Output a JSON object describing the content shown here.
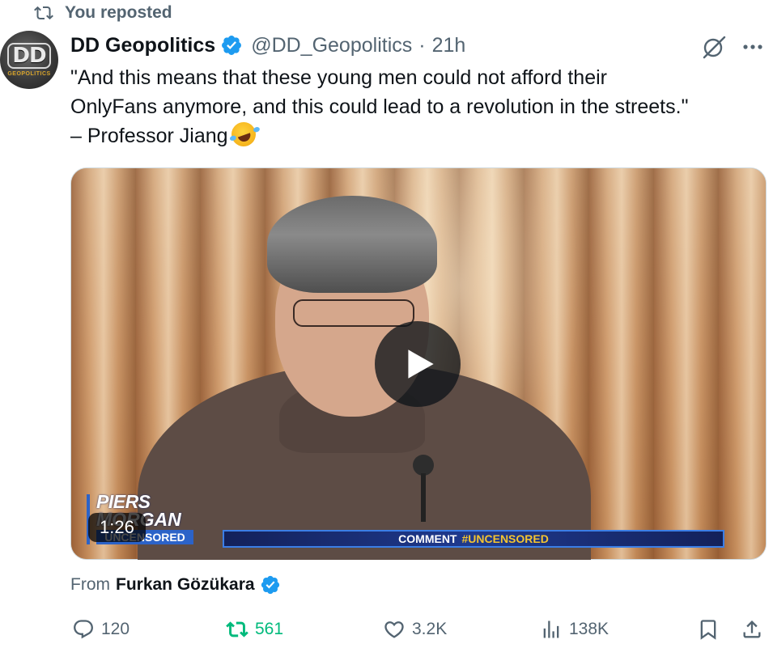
{
  "repost_banner": {
    "text": "You reposted",
    "icon": "repost-icon"
  },
  "author": {
    "name": "DD Geopolitics",
    "handle": "@DD_Geopolitics",
    "separator": "·",
    "time": "21h",
    "verified": true,
    "avatar_text": "DD",
    "avatar_subtext": "GEOPOLITICS"
  },
  "tweet": {
    "line1": "\"And this means that these young men could not afford their",
    "line2": "OnlyFans anymore, and this could lead to a revolution in the streets.\"",
    "line3": "– Professor Jiang",
    "emoji": "rolling-on-floor-laughing-emoji"
  },
  "media": {
    "type": "video",
    "duration": "1:26",
    "overlay_logo": {
      "line1": "PIERS",
      "line2": "MORGAN",
      "line3": "UNCENSORED"
    },
    "ticker": {
      "prefix": "COMMENT",
      "tag": "#UNCENSORED"
    }
  },
  "attribution": {
    "prefix": "From",
    "name": "Furkan Gözükara",
    "verified": true
  },
  "actions": {
    "replies": "120",
    "reposts": "561",
    "likes": "3.2K",
    "views": "138K"
  },
  "colors": {
    "text_primary": "#0f1419",
    "text_secondary": "#536471",
    "verified_blue": "#1d9bf0",
    "repost_green": "#00ba7c"
  }
}
